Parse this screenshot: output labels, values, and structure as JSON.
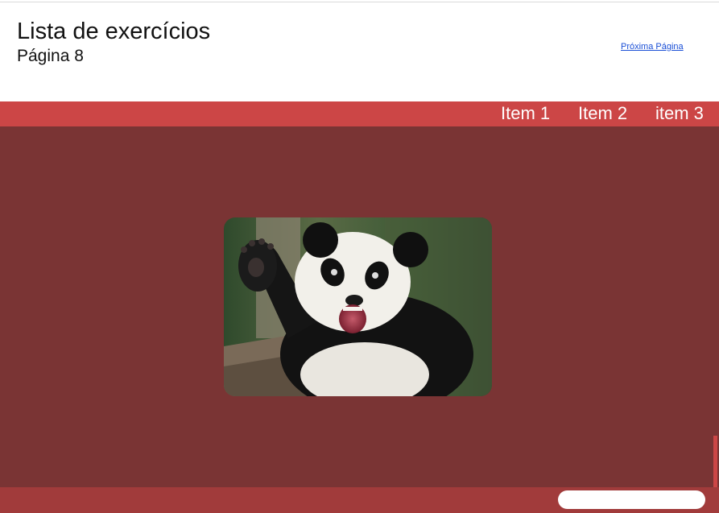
{
  "header": {
    "title": "Lista de exercícios",
    "subtitle": "Página 8",
    "next_link": "Próxima Página"
  },
  "nav": {
    "items": [
      {
        "label": "Item 1"
      },
      {
        "label": "Item 2"
      },
      {
        "label": "item 3"
      }
    ]
  },
  "main": {
    "image": {
      "alt": "panda"
    }
  },
  "colors": {
    "nav_bg": "#cc4646",
    "main_bg": "#7a3434",
    "footer_bg": "#a13b3b",
    "link": "#1a4fd6"
  }
}
